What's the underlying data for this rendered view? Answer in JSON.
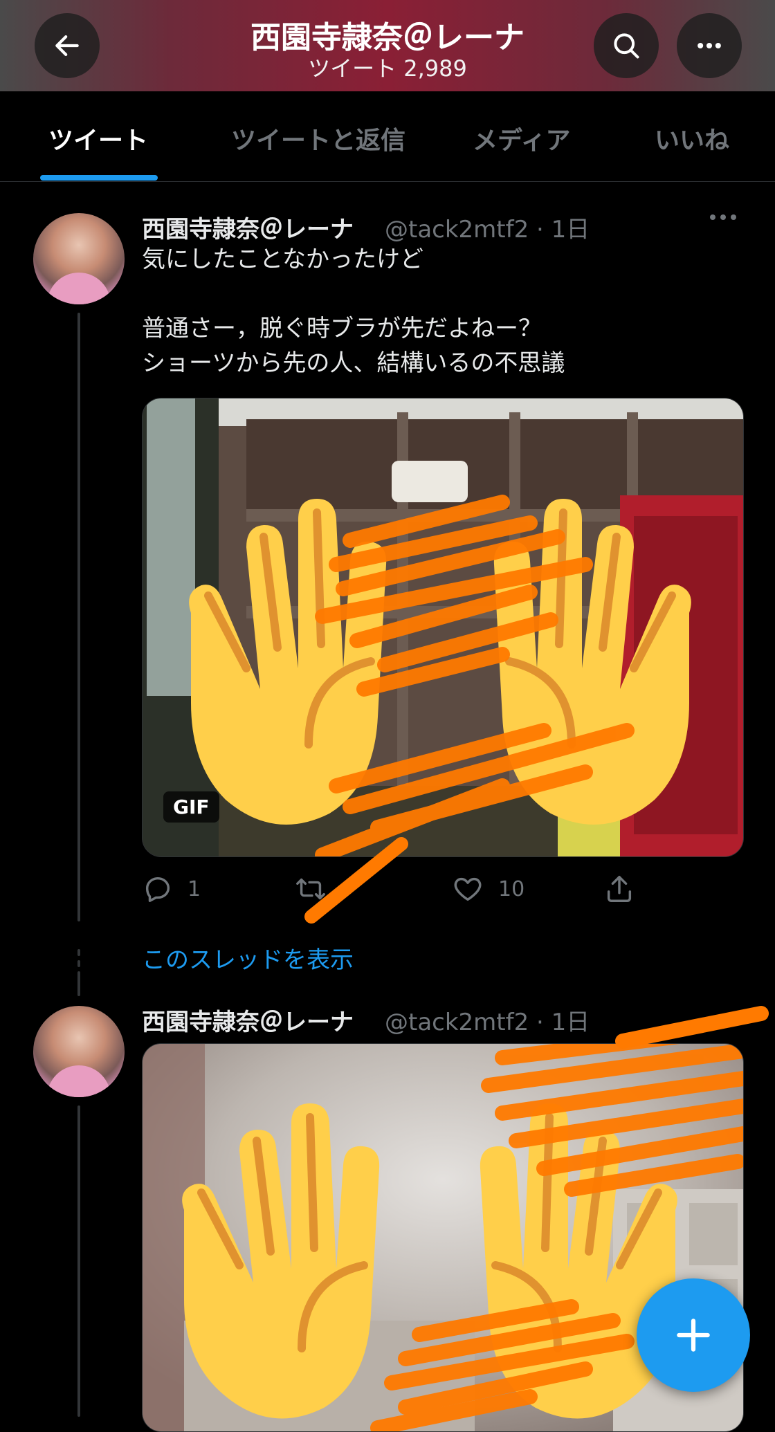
{
  "header": {
    "title": "西園寺隷奈＠レーナ",
    "subtitle": "ツイート 2,989"
  },
  "tabs": [
    {
      "label": "ツイート",
      "active": true
    },
    {
      "label": "ツイートと返信",
      "active": false
    },
    {
      "label": "メディア",
      "active": false
    },
    {
      "label": "いいね",
      "active": false
    }
  ],
  "tweets": [
    {
      "name": "西園寺隷奈＠レーナ",
      "handle_time": "@tack2mtf2 · 1日",
      "lines": [
        "気にしたことなかったけど",
        "",
        "普通さー，脱ぐ時ブラが先だよねー？",
        "ショーツから先の人、結構いるの不思議"
      ],
      "media_badge": "GIF",
      "actions": {
        "reply_count": "1",
        "retweet_count": "",
        "like_count": "10"
      }
    },
    {
      "name": "西園寺隷奈＠レーナ",
      "handle_time": "@tack2mtf2 · 1日"
    }
  ],
  "thread_link": "このスレッドを表示",
  "icons": {
    "back": "arrow-left-icon",
    "search": "search-icon",
    "more": "more-horizontal-icon",
    "reply": "reply-icon",
    "retweet": "retweet-icon",
    "like": "heart-icon",
    "share": "share-icon",
    "compose": "plus-icon"
  },
  "colors": {
    "accent": "#1d9bf0",
    "background": "#000000",
    "muted": "#71767b"
  }
}
